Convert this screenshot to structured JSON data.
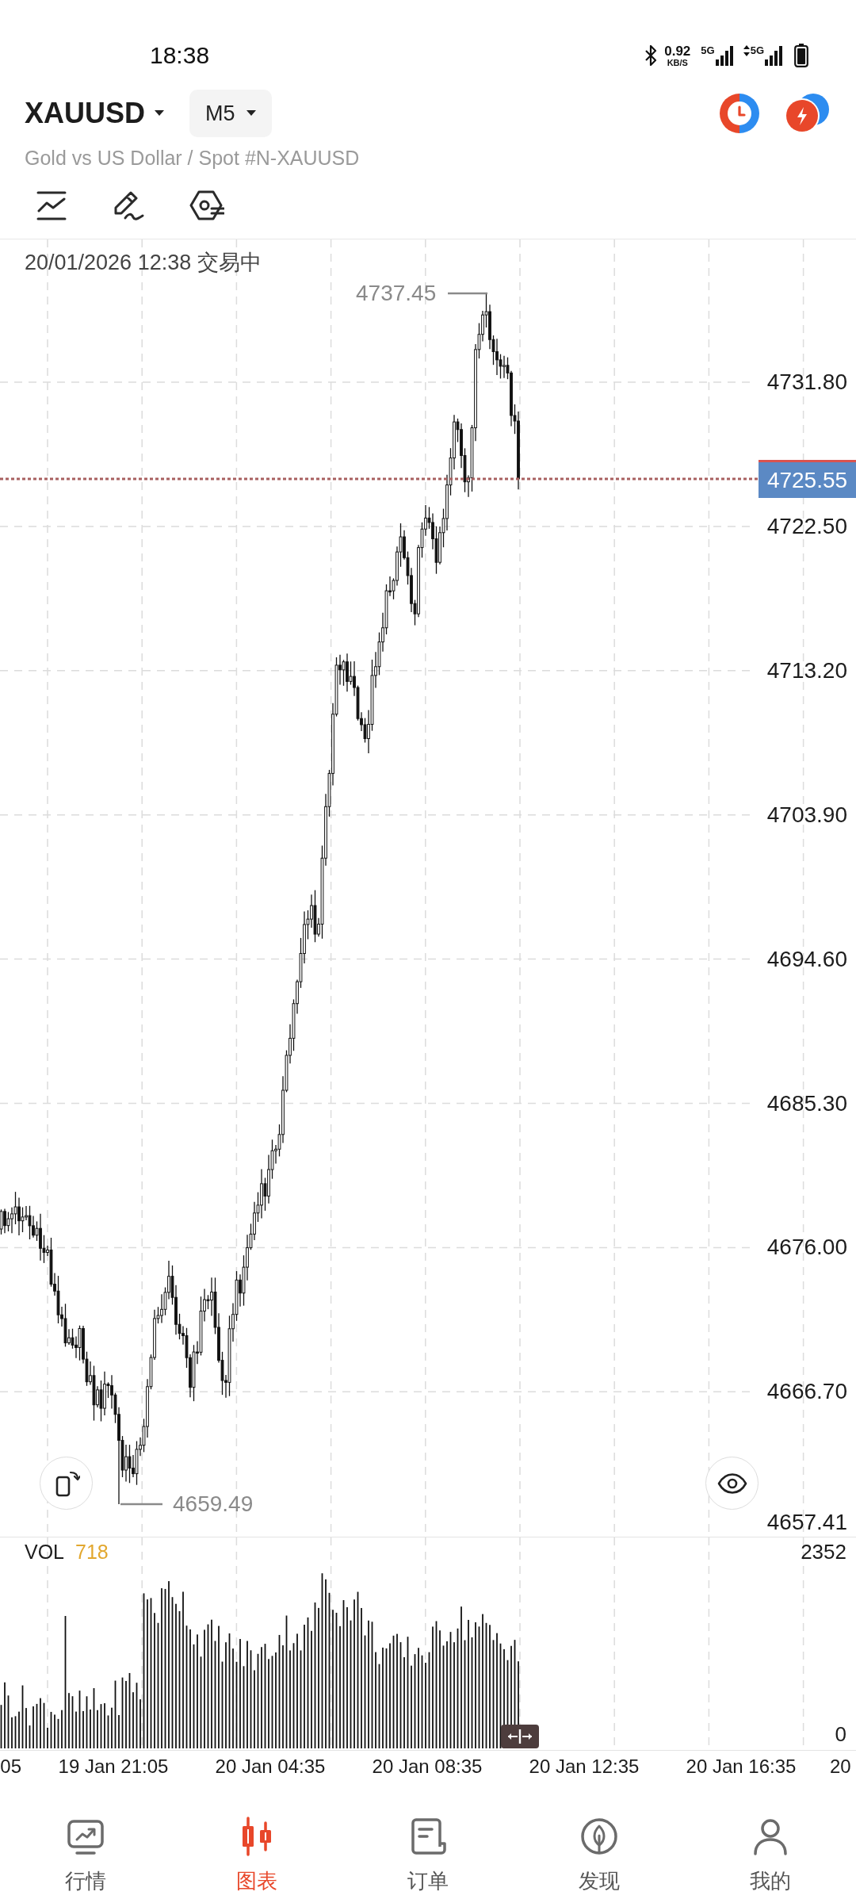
{
  "status_bar": {
    "time": "18:38",
    "net_speed": "0.92",
    "net_speed_unit": "KB/S",
    "networks": [
      "5G",
      "5G"
    ]
  },
  "header": {
    "symbol": "XAUUSD",
    "timeframe": "M5",
    "subtitle": "Gold vs US Dollar / Spot #N-XAUUSD"
  },
  "chart": {
    "timestamp": "20/01/2026 12:38 交易中",
    "high_label": "4737.45",
    "low_label": "4659.49",
    "current_price": "4725.55",
    "price_axis": [
      "4731.80",
      "4722.50",
      "4713.20",
      "4703.90",
      "4694.60",
      "4685.30",
      "4676.00",
      "4666.70",
      "4657.41"
    ]
  },
  "volume": {
    "label": "VOL",
    "value": "718",
    "axis_max": "2352",
    "axis_min": "0"
  },
  "time_axis": [
    "05",
    "19 Jan 21:05",
    "20 Jan 04:35",
    "20 Jan 08:35",
    "20 Jan 12:35",
    "20 Jan 16:35",
    "20"
  ],
  "bottom_nav": [
    {
      "label": "行情",
      "selected": false
    },
    {
      "label": "图表",
      "selected": true
    },
    {
      "label": "订单",
      "selected": false
    },
    {
      "label": "发现",
      "selected": false
    },
    {
      "label": "我的",
      "selected": false
    }
  ]
}
